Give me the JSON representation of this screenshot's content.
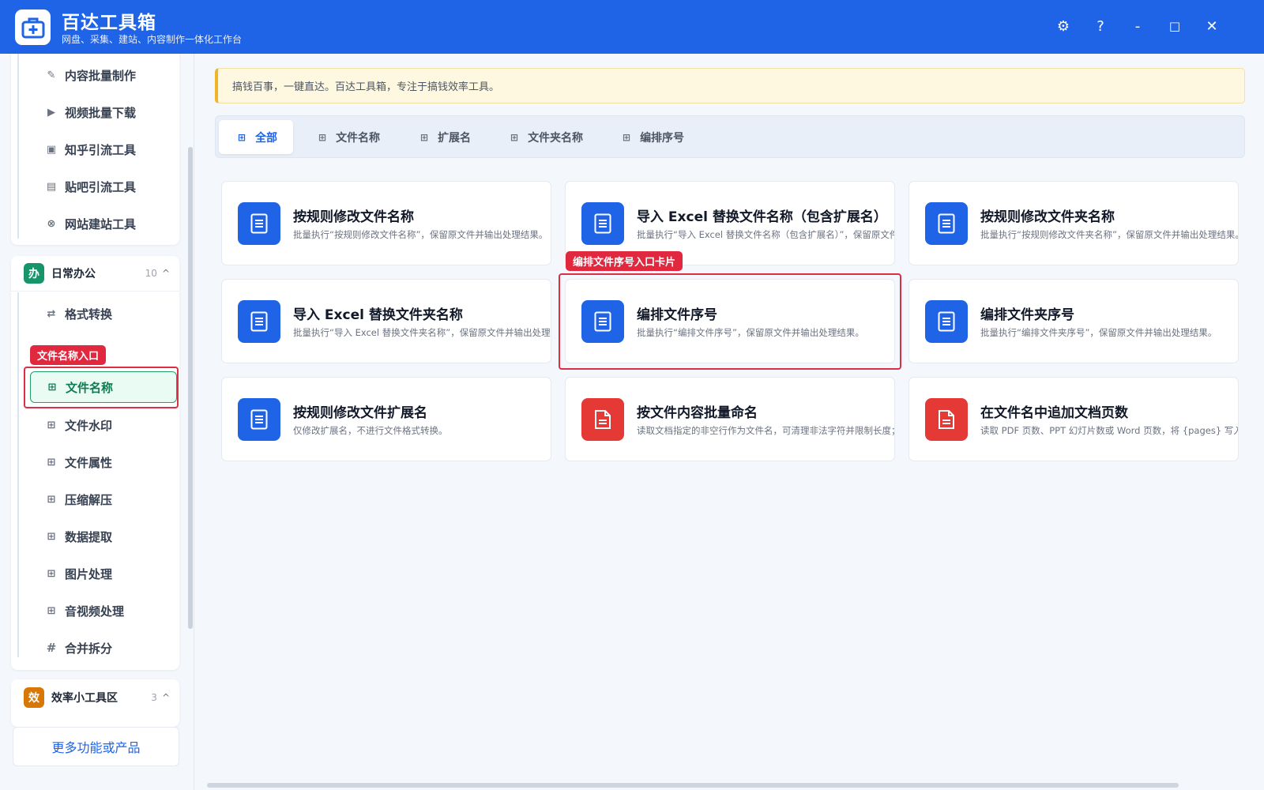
{
  "app": {
    "title": "百达工具箱",
    "subtitle": "网盘、采集、建站、内容制作一体化工作台"
  },
  "window_controls": {
    "settings": "⚙",
    "help": "?",
    "minimize": "-",
    "maximize": "□",
    "close": "✕"
  },
  "sidebar": {
    "top_items": [
      {
        "label": "内容批量制作",
        "icon": "pencil-icon"
      },
      {
        "label": "视频批量下载",
        "icon": "video-icon"
      },
      {
        "label": "知乎引流工具",
        "icon": "zhihu-icon"
      },
      {
        "label": "贴吧引流工具",
        "icon": "list-icon"
      },
      {
        "label": "网站建站工具",
        "icon": "globe-icon"
      }
    ],
    "group_office": {
      "badge": "办",
      "title": "日常办公",
      "count": "10",
      "chevron": "^",
      "items": [
        {
          "label": "格式转换"
        },
        {
          "label": "文件名称"
        },
        {
          "label": "文件水印"
        },
        {
          "label": "文件属性"
        },
        {
          "label": "压缩解压"
        },
        {
          "label": "数据提取"
        },
        {
          "label": "图片处理"
        },
        {
          "label": "音视频处理"
        },
        {
          "label": "合并拆分"
        }
      ]
    },
    "group_efficiency": {
      "badge": "效",
      "title": "效率小工具区",
      "count": "3",
      "chevron": "^"
    },
    "more_button": "更多功能或产品"
  },
  "notice": "搞钱百事，一键直达。百达工具箱，专注于搞钱效率工具。",
  "tabs": [
    {
      "label": "全部",
      "active": true
    },
    {
      "label": "文件名称"
    },
    {
      "label": "扩展名"
    },
    {
      "label": "文件夹名称"
    },
    {
      "label": "编排序号"
    }
  ],
  "cards": [
    {
      "title": "按规则修改文件名称",
      "desc": "批量执行“按规则修改文件名称”，保留原文件并输出处理结果。",
      "color": "blue"
    },
    {
      "title": "导入 Excel 替换文件名称（包含扩展名）",
      "desc": "批量执行“导入 Excel 替换文件名称（包含扩展名）”，保留原文件并输出处理结果。",
      "color": "blue"
    },
    {
      "title": "按规则修改文件夹名称",
      "desc": "批量执行“按规则修改文件夹名称”，保留原文件并输出处理结果。",
      "color": "blue"
    },
    {
      "title": "导入 Excel 替换文件夹名称",
      "desc": "批量执行“导入 Excel 替换文件夹名称”，保留原文件并输出处理结果。",
      "color": "blue"
    },
    {
      "title": "编排文件序号",
      "desc": "批量执行“编排文件序号”，保留原文件并输出处理结果。",
      "color": "blue"
    },
    {
      "title": "编排文件夹序号",
      "desc": "批量执行“编排文件夹序号”，保留原文件并输出处理结果。",
      "color": "blue"
    },
    {
      "title": "按规则修改文件扩展名",
      "desc": "仅修改扩展名，不进行文件格式转换。",
      "color": "blue"
    },
    {
      "title": "按文件内容批量命名",
      "desc": "读取文档指定的非空行作为文件名，可清理非法字符并限制长度；",
      "color": "red"
    },
    {
      "title": "在文件名中追加文档页数",
      "desc": "读取 PDF 页数、PPT 幻灯片数或 Word 页数，将 {pages} 写入命名规则。",
      "color": "red"
    }
  ],
  "annotations": {
    "sidebar_tag": "文件名称入口",
    "card_tag": "编排文件序号入口卡片"
  },
  "colors": {
    "brand": "#1f63e6",
    "active_green": "#23a06a",
    "highlight_red": "#dc2f45",
    "office_badge": "#16946a",
    "efficiency_badge": "#d97706"
  }
}
